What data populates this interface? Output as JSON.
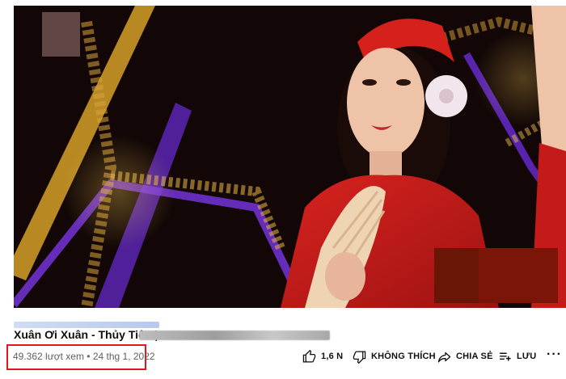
{
  "video": {
    "title_visible": "Xuân Ơi Xuân - Thủy Tiên | ",
    "views": "49.362 lượt xem",
    "separator": " • ",
    "date": "24 thg 1, 2022"
  },
  "actions": {
    "like_count": "1,6 N",
    "dislike_label": "KHÔNG THÍCH",
    "share_label": "CHIA SẺ",
    "save_label": "LƯU",
    "more_label": "···"
  },
  "colors": {
    "highlight_border": "#e3161d",
    "title_text": "#0f0f0f",
    "meta_text": "#606060",
    "dress_red": "#c41a1a"
  },
  "icons": {
    "like": "thumbs-up-icon",
    "dislike": "thumbs-down-icon",
    "share": "share-arrow-icon",
    "save": "playlist-add-icon",
    "more": "more-horizontal-icon"
  }
}
